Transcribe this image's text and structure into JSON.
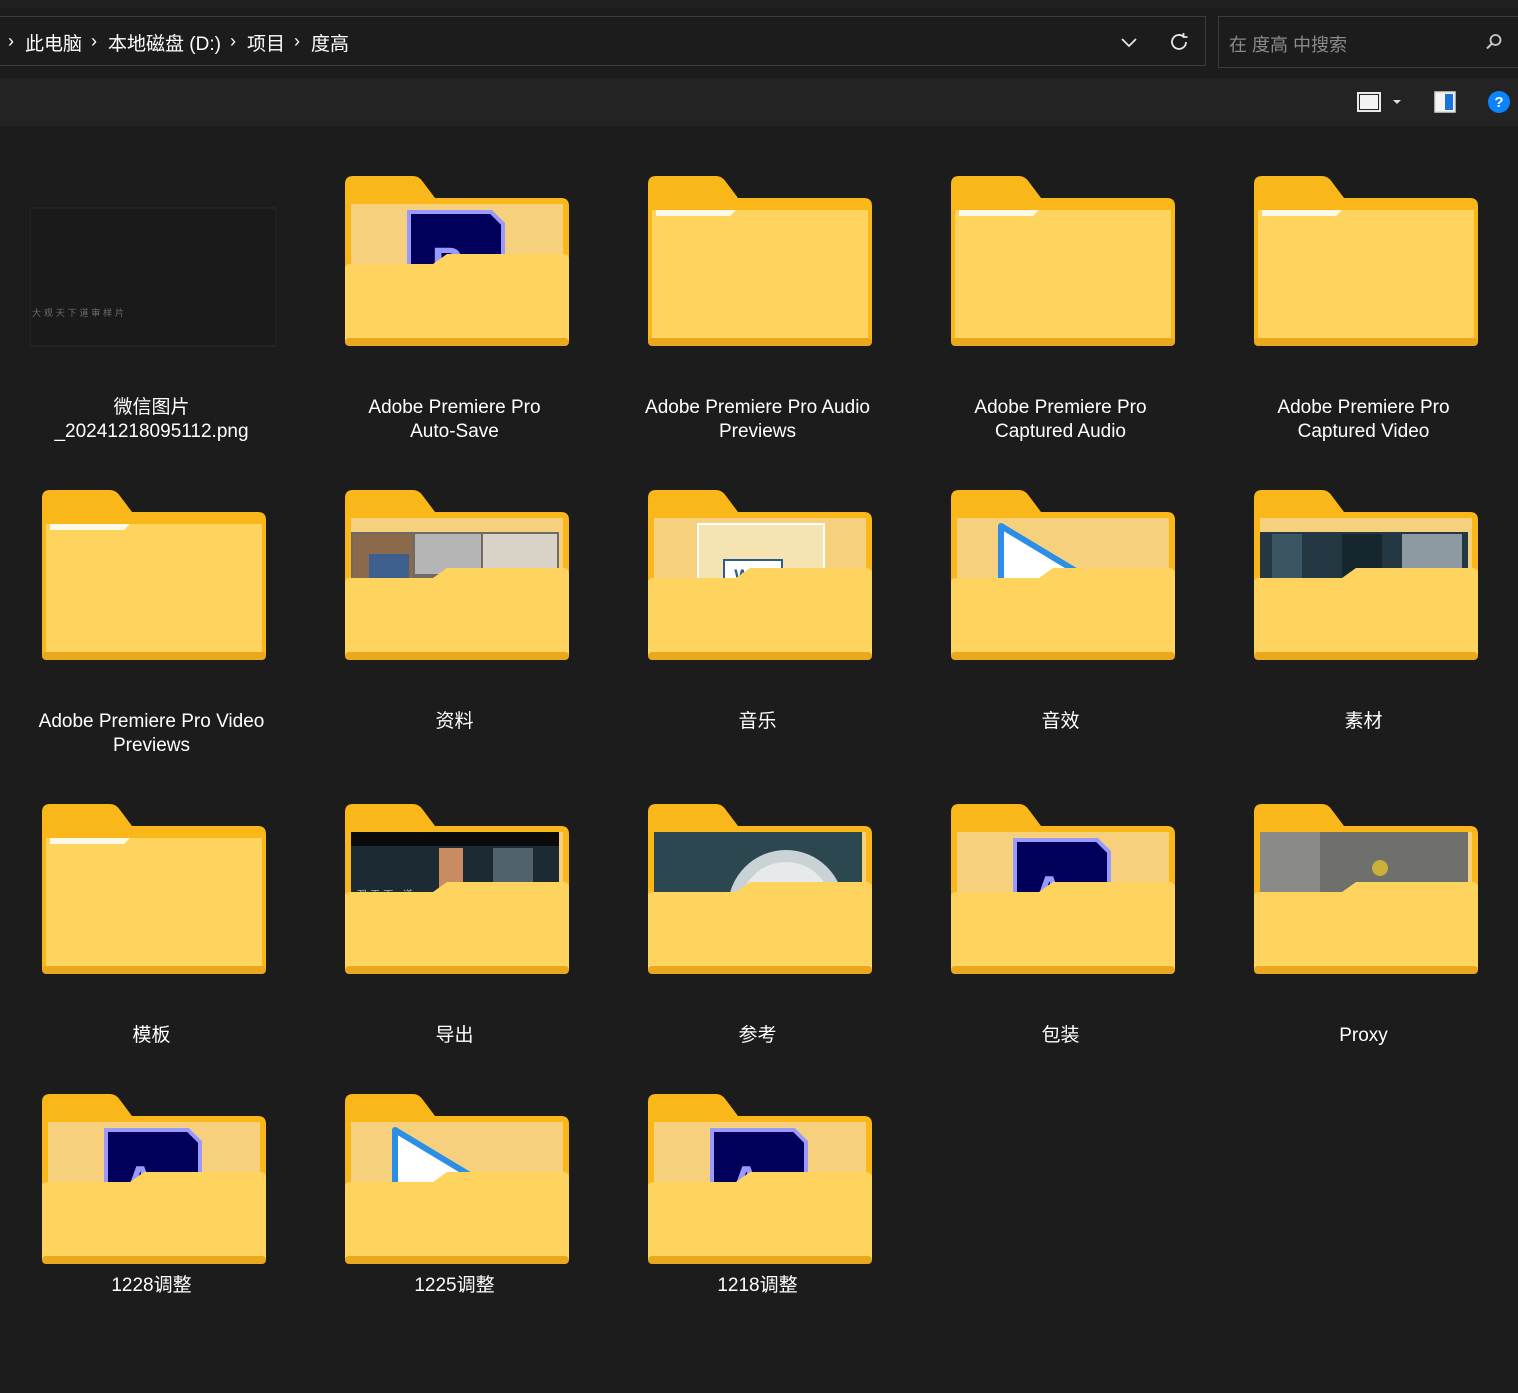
{
  "breadcrumb": {
    "items": [
      "此电脑",
      "本地磁盘 (D:)",
      "项目",
      "度高"
    ]
  },
  "search": {
    "placeholder": "在 度高 中搜索"
  },
  "icons": {
    "nav": [
      "chevron-down-icon",
      "refresh-icon",
      "search-icon"
    ],
    "toolbar": [
      "view-icon",
      "view-dropdown-icon",
      "preview-pane-icon",
      "help-icon"
    ]
  },
  "files": [
    {
      "name": "微信图片\n_20241218095112.png",
      "type": "image",
      "caption": "大 观 天 下   道 审 样 片"
    },
    {
      "name": "Adobe Premiere Pro\nAuto-Save",
      "type": "folder",
      "content": "premiere"
    },
    {
      "name": "Adobe Premiere Pro Audio\nPreviews",
      "type": "folder",
      "content": "empty"
    },
    {
      "name": "Adobe Premiere Pro\nCaptured Audio",
      "type": "folder",
      "content": "empty"
    },
    {
      "name": "Adobe Premiere Pro\nCaptured Video",
      "type": "folder",
      "content": "empty"
    },
    {
      "name": "Adobe Premiere Pro Video\nPreviews",
      "type": "folder",
      "content": "empty"
    },
    {
      "name": "资料",
      "type": "folder",
      "content": "photos"
    },
    {
      "name": "音乐",
      "type": "folder",
      "content": "wav",
      "badge": "WAV"
    },
    {
      "name": "音效",
      "type": "folder",
      "content": "play"
    },
    {
      "name": "素材",
      "type": "folder",
      "content": "city"
    },
    {
      "name": "模板",
      "type": "folder",
      "content": "empty"
    },
    {
      "name": "导出",
      "type": "folder",
      "content": "dark-city",
      "caption": "观 天 下 · 道"
    },
    {
      "name": "参考",
      "type": "folder",
      "content": "tunnel"
    },
    {
      "name": "包装",
      "type": "folder",
      "content": "aftereffects"
    },
    {
      "name": "Proxy",
      "type": "folder",
      "content": "gray"
    },
    {
      "name": "1228调整",
      "type": "folder",
      "content": "aftereffects"
    },
    {
      "name": "1225调整",
      "type": "folder",
      "content": "play"
    },
    {
      "name": "1218调整",
      "type": "folder",
      "content": "aftereffects"
    }
  ],
  "app_icons": {
    "premiere": "Pr",
    "aftereffects": "Ae"
  },
  "colors": {
    "background": "#1c1c1c",
    "folder_back": "#f9b71a",
    "folder_front": "#ffd45e",
    "premiere_bg": "#00005b",
    "premiere_text": "#9999ff",
    "aftereffects_text": "#9999ff",
    "help_blue": "#0a84ff"
  }
}
